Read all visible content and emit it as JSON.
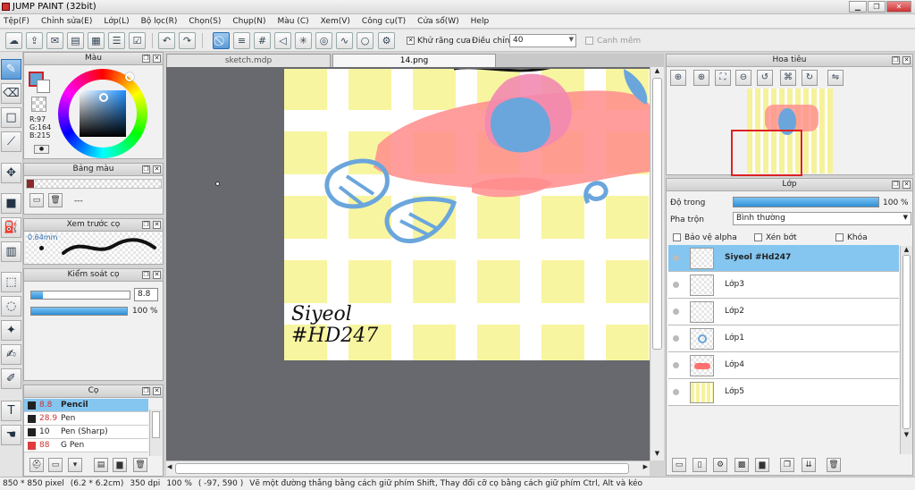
{
  "window": {
    "title": "JUMP PAINT (32bit)"
  },
  "menu": [
    "Tệp(F)",
    "Chỉnh sửa(E)",
    "Lớp(L)",
    "Bộ lọc(R)",
    "Chọn(S)",
    "Chụp(N)",
    "Màu (C)",
    "Xem(V)",
    "Công cụ(T)",
    "Cửa sổ(W)",
    "Help"
  ],
  "toolbar": {
    "antialias_label": "Khử răng cưa",
    "adjust_label": "Điều chỉnh",
    "adjust_value": "40",
    "snap_label": "Canh mềm"
  },
  "color_panel": {
    "title": "Màu",
    "r": "R:97",
    "g": "G:164",
    "b": "B:215",
    "main_color": "#61a4d7"
  },
  "palette_panel": {
    "title": "Bảng màu",
    "dash": "---"
  },
  "preview_panel": {
    "title": "Xem trước cọ",
    "size": "0.64mm"
  },
  "brush_control": {
    "title": "Kiểm soát cọ",
    "size_value": "8.8",
    "opacity_value": "100 %",
    "size_level": 0.12,
    "opacity_level": 1.0
  },
  "brush_panel": {
    "title": "Cọ",
    "items": [
      {
        "size": "8.8",
        "name": "Pencil",
        "color": "#222222"
      },
      {
        "size": "28.9",
        "name": "Pen",
        "color": "#222222"
      },
      {
        "size": "10",
        "name": "Pen (Sharp)",
        "color": "#222222"
      },
      {
        "size": "88",
        "name": "G Pen",
        "color": "#e03c3c"
      }
    ]
  },
  "tabs": [
    {
      "label": "sketch.mdp"
    },
    {
      "label": "14.png"
    }
  ],
  "canvas": {
    "signature_line1": "Siyeol",
    "signature_line2": "#HD247"
  },
  "navigator": {
    "title": "Hoa tiêu"
  },
  "layers": {
    "title": "Lớp",
    "opacity_label": "Độ trong",
    "opacity_value": "100 %",
    "opacity_level": 1.0,
    "blend_label": "Pha trộn",
    "blend_value": "Bình thường",
    "protect_alpha": "Bảo vệ alpha",
    "clipping": "Xén bớt",
    "lock": "Khóa",
    "items": [
      {
        "name": "Siyeol #Hd247"
      },
      {
        "name": "Lớp3"
      },
      {
        "name": "Lớp2"
      },
      {
        "name": "Lớp1"
      },
      {
        "name": "Lớp4"
      },
      {
        "name": "Lớp5"
      }
    ]
  },
  "status": {
    "size": "850 * 850 pixel",
    "cm": "(6.2 * 6.2cm)",
    "dpi": "350 dpi",
    "zoom": "100 %",
    "coords": "( -97, 590 )",
    "hint": "Vẽ một đường thẳng bằng cách giữ phím Shift, Thay đổi cỡ cọ bằng cách giữ phím Ctrl, Alt và kéo"
  },
  "colors": {
    "accent": "#5b9ad6",
    "selected_row": "#84c6f0",
    "canvas_bg": "#67696e"
  }
}
